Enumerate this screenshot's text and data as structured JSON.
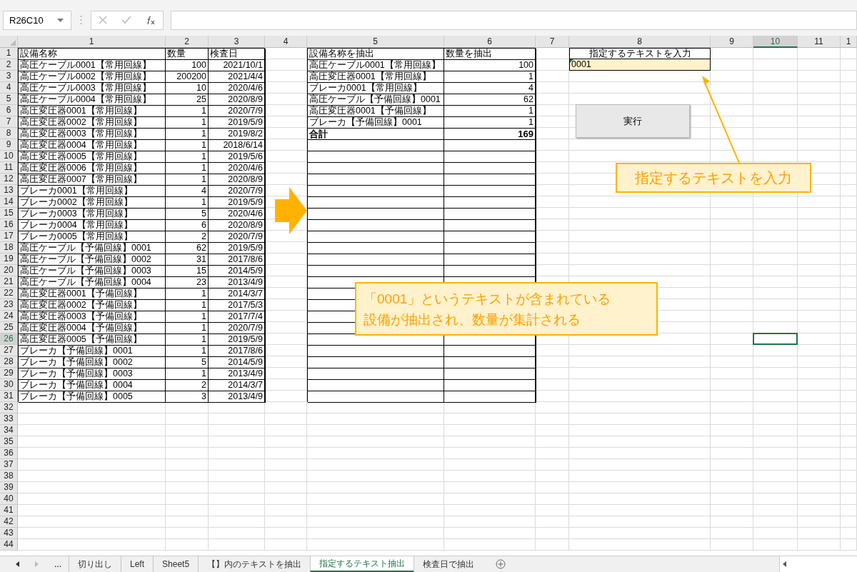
{
  "formula_bar": {
    "name_box": "R26C10"
  },
  "sheet": {
    "columns": [
      {
        "label": "1",
        "selected": false
      },
      {
        "label": "2",
        "selected": false
      },
      {
        "label": "3",
        "selected": false
      },
      {
        "label": "4",
        "selected": false
      },
      {
        "label": "5",
        "selected": false
      },
      {
        "label": "6",
        "selected": false
      },
      {
        "label": "7",
        "selected": false
      },
      {
        "label": "8",
        "selected": false
      },
      {
        "label": "9",
        "selected": false
      },
      {
        "label": "10",
        "selected": true
      },
      {
        "label": "11",
        "selected": false
      },
      {
        "label": "1",
        "selected": false
      }
    ],
    "rows": [
      {
        "label": "1",
        "selected": false
      },
      {
        "label": "2",
        "selected": false
      },
      {
        "label": "3",
        "selected": false
      },
      {
        "label": "4",
        "selected": false
      },
      {
        "label": "5",
        "selected": false
      },
      {
        "label": "6",
        "selected": false
      },
      {
        "label": "7",
        "selected": false
      },
      {
        "label": "8",
        "selected": false
      },
      {
        "label": "9",
        "selected": false
      },
      {
        "label": "10",
        "selected": false
      },
      {
        "label": "11",
        "selected": false
      },
      {
        "label": "12",
        "selected": false
      },
      {
        "label": "13",
        "selected": false
      },
      {
        "label": "14",
        "selected": false
      },
      {
        "label": "15",
        "selected": false
      },
      {
        "label": "16",
        "selected": false
      },
      {
        "label": "17",
        "selected": false
      },
      {
        "label": "18",
        "selected": false
      },
      {
        "label": "19",
        "selected": false
      },
      {
        "label": "20",
        "selected": false
      },
      {
        "label": "21",
        "selected": false
      },
      {
        "label": "22",
        "selected": false
      },
      {
        "label": "23",
        "selected": false
      },
      {
        "label": "24",
        "selected": false
      },
      {
        "label": "25",
        "selected": false
      },
      {
        "label": "26",
        "selected": true
      },
      {
        "label": "27",
        "selected": false
      },
      {
        "label": "28",
        "selected": false
      },
      {
        "label": "29",
        "selected": false
      },
      {
        "label": "30",
        "selected": false
      },
      {
        "label": "31",
        "selected": false
      },
      {
        "label": "32",
        "selected": false
      },
      {
        "label": "33",
        "selected": false
      },
      {
        "label": "34",
        "selected": false
      },
      {
        "label": "35",
        "selected": false
      },
      {
        "label": "36",
        "selected": false
      },
      {
        "label": "37",
        "selected": false
      },
      {
        "label": "38",
        "selected": false
      },
      {
        "label": "39",
        "selected": false
      },
      {
        "label": "40",
        "selected": false
      },
      {
        "label": "41",
        "selected": false
      },
      {
        "label": "42",
        "selected": false
      },
      {
        "label": "43",
        "selected": false
      },
      {
        "label": "44",
        "selected": false
      }
    ]
  },
  "source_table": {
    "header": [
      "設備名称",
      "数量",
      "検査日"
    ],
    "rows": [
      [
        "高圧ケーブル0001【常用回線】",
        "100",
        "2021/10/1"
      ],
      [
        "高圧ケーブル0002【常用回線】",
        "200200",
        "2021/4/4"
      ],
      [
        "高圧ケーブル0003【常用回線】",
        "10",
        "2020/4/6"
      ],
      [
        "高圧ケーブル0004【常用回線】",
        "25",
        "2020/8/9"
      ],
      [
        "高圧変圧器0001【常用回線】",
        "1",
        "2020/7/9"
      ],
      [
        "高圧変圧器0002【常用回線】",
        "1",
        "2019/5/9"
      ],
      [
        "高圧変圧器0003【常用回線】",
        "1",
        "2019/8/2"
      ],
      [
        "高圧変圧器0004【常用回線】",
        "1",
        "2018/6/14"
      ],
      [
        "高圧変圧器0005【常用回線】",
        "1",
        "2019/5/6"
      ],
      [
        "高圧変圧器0006【常用回線】",
        "1",
        "2020/4/6"
      ],
      [
        "高圧変圧器0007【常用回線】",
        "1",
        "2020/8/9"
      ],
      [
        "ブレーカ0001【常用回線】",
        "4",
        "2020/7/9"
      ],
      [
        "ブレーカ0002【常用回線】",
        "1",
        "2019/5/9"
      ],
      [
        "ブレーカ0003【常用回線】",
        "5",
        "2020/4/6"
      ],
      [
        "ブレーカ0004【常用回線】",
        "6",
        "2020/8/9"
      ],
      [
        "ブレーカ0005【常用回線】",
        "2",
        "2020/7/9"
      ],
      [
        "高圧ケーブル【予備回線】0001",
        "62",
        "2019/5/9"
      ],
      [
        "高圧ケーブル【予備回線】0002",
        "31",
        "2017/8/6"
      ],
      [
        "高圧ケーブル【予備回線】0003",
        "15",
        "2014/5/9"
      ],
      [
        "高圧ケーブル【予備回線】0004",
        "23",
        "2013/4/9"
      ],
      [
        "高圧変圧器0001【予備回線】",
        "1",
        "2014/3/7"
      ],
      [
        "高圧変圧器0002【予備回線】",
        "1",
        "2017/5/3"
      ],
      [
        "高圧変圧器0003【予備回線】",
        "1",
        "2017/7/4"
      ],
      [
        "高圧変圧器0004【予備回線】",
        "1",
        "2020/7/9"
      ],
      [
        "高圧変圧器0005【予備回線】",
        "1",
        "2019/5/9"
      ],
      [
        "ブレーカ【予備回線】0001",
        "1",
        "2017/8/6"
      ],
      [
        "ブレーカ【予備回線】0002",
        "5",
        "2014/5/9"
      ],
      [
        "ブレーカ【予備回線】0003",
        "1",
        "2013/4/9"
      ],
      [
        "ブレーカ【予備回線】0004",
        "2",
        "2014/3/7"
      ],
      [
        "ブレーカ【予備回線】0005",
        "3",
        "2013/4/9"
      ]
    ]
  },
  "result_table": {
    "header": [
      "設備名称を抽出",
      "数量を抽出"
    ],
    "rows": [
      [
        "高圧ケーブル0001【常用回線】",
        "100"
      ],
      [
        "高圧変圧器0001【常用回線】",
        "1"
      ],
      [
        "ブレーカ0001【常用回線】",
        "4"
      ],
      [
        "高圧ケーブル【予備回線】0001",
        "62"
      ],
      [
        "高圧変圧器0001【予備回線】",
        "1"
      ],
      [
        "ブレーカ【予備回線】0001",
        "1"
      ]
    ],
    "total": {
      "label": "合計",
      "value": "169"
    }
  },
  "input": {
    "label": "指定するテキストを入力",
    "value": "0001"
  },
  "run_button": "実行",
  "callout_input": "指定するテキストを入力",
  "callout_result": {
    "lines": [
      "「0001」というテキストが含まれている",
      "設備が抽出され、数量が集計される"
    ]
  },
  "sheet_tabs": [
    {
      "label": "切り出し",
      "selected": false
    },
    {
      "label": "Left",
      "selected": false
    },
    {
      "label": "Sheet5",
      "selected": false
    },
    {
      "label": "【】内のテキストを抽出",
      "selected": false
    },
    {
      "label": "指定するテキスト抽出",
      "selected": true
    },
    {
      "label": "検査日で抽出",
      "selected": false
    }
  ],
  "tab_overflow": "..."
}
